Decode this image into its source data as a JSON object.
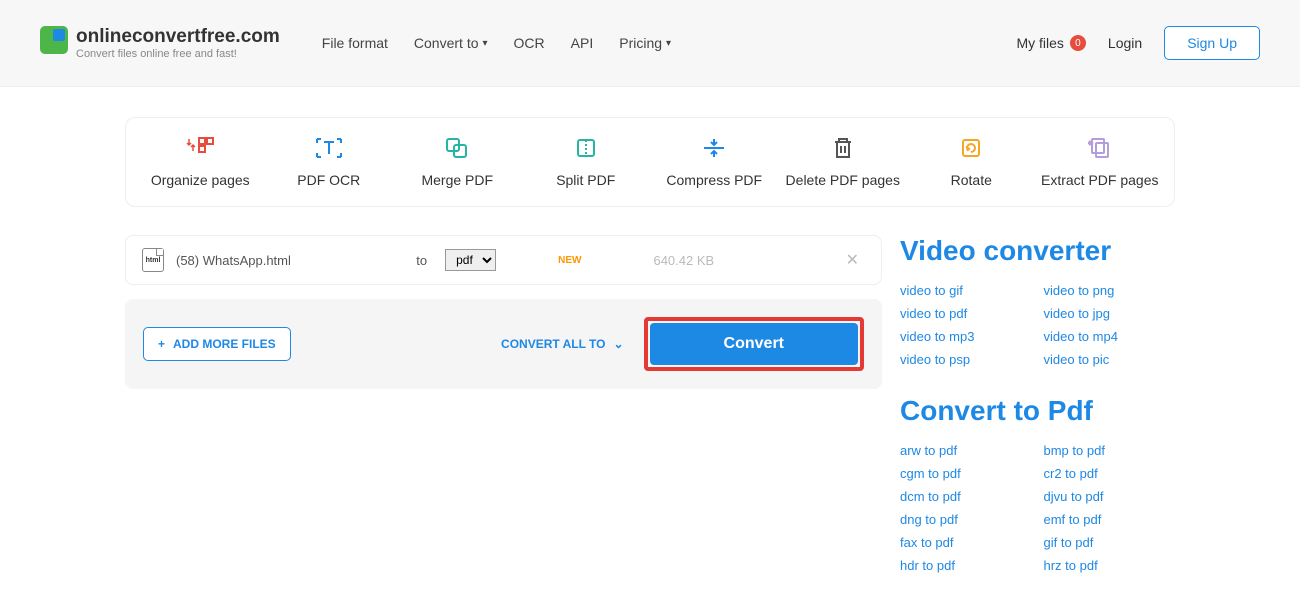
{
  "brand": {
    "name": "onlineconvertfree.com",
    "slogan": "Convert files online free and fast!"
  },
  "nav": {
    "file_format": "File format",
    "convert_to": "Convert to",
    "ocr": "OCR",
    "api": "API",
    "pricing": "Pricing"
  },
  "header_right": {
    "my_files": "My files",
    "my_files_count": "0",
    "login": "Login",
    "signup": "Sign Up"
  },
  "tools": {
    "organize": "Organize pages",
    "ocr": "PDF OCR",
    "merge": "Merge PDF",
    "split": "Split PDF",
    "compress": "Compress PDF",
    "delete": "Delete PDF pages",
    "rotate": "Rotate",
    "extract": "Extract PDF pages"
  },
  "file": {
    "icon_text": "html",
    "name": "(58) WhatsApp.html",
    "to_label": "to",
    "format": "pdf",
    "new_badge": "NEW",
    "size": "640.42 KB"
  },
  "actions": {
    "add_more": "ADD MORE FILES",
    "convert_all": "CONVERT ALL TO",
    "convert": "Convert"
  },
  "sidebar": {
    "video_title": "Video converter",
    "video_links": [
      "video to gif",
      "video to png",
      "video to pdf",
      "video to jpg",
      "video to mp3",
      "video to mp4",
      "video to psp",
      "video to pic"
    ],
    "pdf_title": "Convert to Pdf",
    "pdf_links": [
      "arw to pdf",
      "bmp to pdf",
      "cgm to pdf",
      "cr2 to pdf",
      "dcm to pdf",
      "djvu to pdf",
      "dng to pdf",
      "emf to pdf",
      "fax to pdf",
      "gif to pdf",
      "hdr to pdf",
      "hrz to pdf"
    ]
  },
  "icons": {
    "organize_color": "#e74c3c",
    "ocr_color": "#1e88e5",
    "merge_color": "#26b5a4",
    "split_color": "#26b5a4",
    "compress_color": "#1e88e5",
    "delete_color": "#555",
    "rotate_color": "#f5a623",
    "extract_color": "#b39ddb"
  }
}
